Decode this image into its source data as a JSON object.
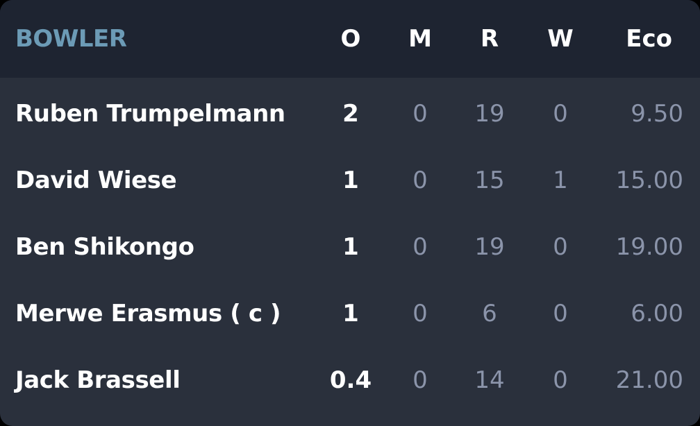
{
  "header": {
    "bowler": "BOWLER",
    "overs": "O",
    "maidens": "M",
    "runs": "R",
    "wickets": "W",
    "economy": "Eco"
  },
  "bowlers": [
    {
      "name": "Ruben Trumpelmann",
      "overs": "2",
      "maidens": "0",
      "runs": "19",
      "wickets": "0",
      "economy": "9.50"
    },
    {
      "name": "David Wiese",
      "overs": "1",
      "maidens": "0",
      "runs": "15",
      "wickets": "1",
      "economy": "15.00"
    },
    {
      "name": "Ben Shikongo",
      "overs": "1",
      "maidens": "0",
      "runs": "19",
      "wickets": "0",
      "economy": "19.00"
    },
    {
      "name": "Merwe Erasmus ( c )",
      "overs": "1",
      "maidens": "0",
      "runs": "6",
      "wickets": "0",
      "economy": "6.00"
    },
    {
      "name": "Jack Brassell",
      "overs": "0.4",
      "maidens": "0",
      "runs": "14",
      "wickets": "0",
      "economy": "21.00"
    }
  ],
  "colors": {
    "background": "#2a303c",
    "header_background": "#1e2431",
    "header_accent": "#6c9bb6",
    "primary_text": "#ffffff",
    "secondary_text": "#8b94aa"
  }
}
